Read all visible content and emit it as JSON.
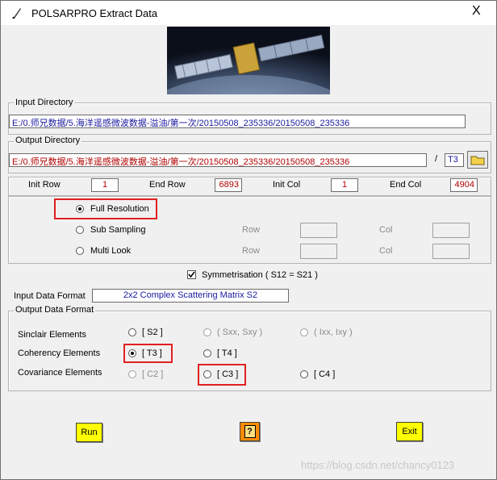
{
  "window": {
    "title": "POLSARPRO Extract Data",
    "close_glyph": "X"
  },
  "input_directory": {
    "legend": "Input Directory",
    "value": "E:/0.师兄数据/5.海洋遥感微波数据-溢油/第一次/20150508_235336/20150508_235336"
  },
  "output_directory": {
    "legend": "Output Directory",
    "value": "E:/0.师兄数据/5.海洋遥感微波数据-溢油/第一次/20150508_235336/20150508_235336",
    "separator": "/",
    "suffix": "T3"
  },
  "ranges": {
    "init_row_label": "Init Row",
    "init_row": "1",
    "end_row_label": "End Row",
    "end_row": "6893",
    "init_col_label": "Init Col",
    "init_col": "1",
    "end_col_label": "End Col",
    "end_col": "4904"
  },
  "resolution": {
    "full": "Full Resolution",
    "sub": "Sub Sampling",
    "multi": "Multi Look",
    "row_label": "Row",
    "col_label": "Col",
    "selected": "full"
  },
  "symmetrisation": {
    "label": "Symmetrisation ( S12 = S21 )",
    "checked": true
  },
  "input_format": {
    "label": "Input Data Format",
    "value": "2x2 Complex Scattering Matrix S2"
  },
  "output_format": {
    "legend": "Output Data Format",
    "sinclair_label": "Sinclair Elements",
    "coherency_label": "Coherency Elements",
    "covariance_label": "Covariance Elements",
    "s2": "[ S2 ]",
    "sxx_sxy": "( Sxx, Sxy )",
    "ixx_ixy": "( Ixx, Ixy )",
    "t3": "[ T3 ]",
    "t4": "[ T4 ]",
    "c2": "[ C2 ]",
    "c3": "[ C3 ]",
    "c4": "[ C4 ]",
    "selected": "t3"
  },
  "buttons": {
    "run": "Run",
    "help": "?",
    "exit": "Exit"
  },
  "watermark": "https://blog.csdn.net/chancy0123",
  "colors": {
    "highlight": "#e02020",
    "button": "#ffff00",
    "help_button": "#ff8c00",
    "input_text": "#1a1aa0",
    "range_text": "#b00000"
  }
}
